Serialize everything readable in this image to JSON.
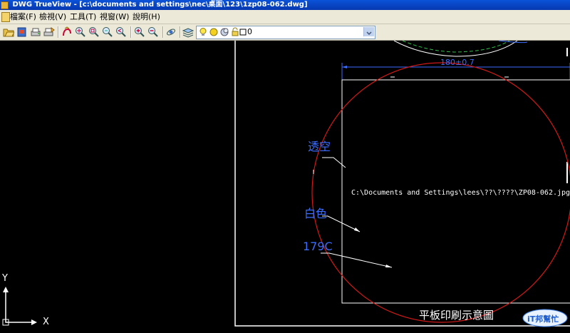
{
  "window": {
    "title": "DWG TrueView - [c:\\documents and settings\\nec\\桌面\\123\\1zp08-062.dwg]"
  },
  "menu": {
    "items": [
      {
        "label": "檔案(F)"
      },
      {
        "label": "檢視(V)"
      },
      {
        "label": "工具(T)"
      },
      {
        "label": "視窗(W)"
      },
      {
        "label": "說明(H)"
      }
    ]
  },
  "toolbar": {
    "layer_value": "0",
    "icons": [
      "open-icon",
      "publish-icon",
      "plot-icon",
      "batch-plot-icon",
      "pan-realtime-icon",
      "zoom-realtime-icon",
      "zoom-window-icon",
      "zoom-dynamic-icon",
      "zoom-previous-icon",
      "zoom-in-icon",
      "zoom-out-icon",
      "orbit-icon",
      "layer-manager-icon",
      "light-bulb-icon",
      "sun-icon",
      "freeze-icon",
      "lock-icon",
      "color-swatch-icon"
    ]
  },
  "drawing": {
    "dimension_text": "180±0.7",
    "image_path_text": "C:\\Documents and Settings\\lees\\??\\????\\ZP08-062.jpg",
    "callouts": [
      {
        "label": "透空"
      },
      {
        "label": "白色"
      },
      {
        "label": "179C"
      }
    ],
    "caption": "平板印刷示意圖",
    "ucs": {
      "x_label": "X",
      "y_label": "Y"
    },
    "colors": {
      "circle": "#d01818",
      "dimension": "#3b6dff",
      "callout_text": "#3a6cff",
      "frame": "#ffffff",
      "arc_dashed": "#2ec24a"
    }
  },
  "watermark": {
    "text": "iT邦幫忙"
  }
}
